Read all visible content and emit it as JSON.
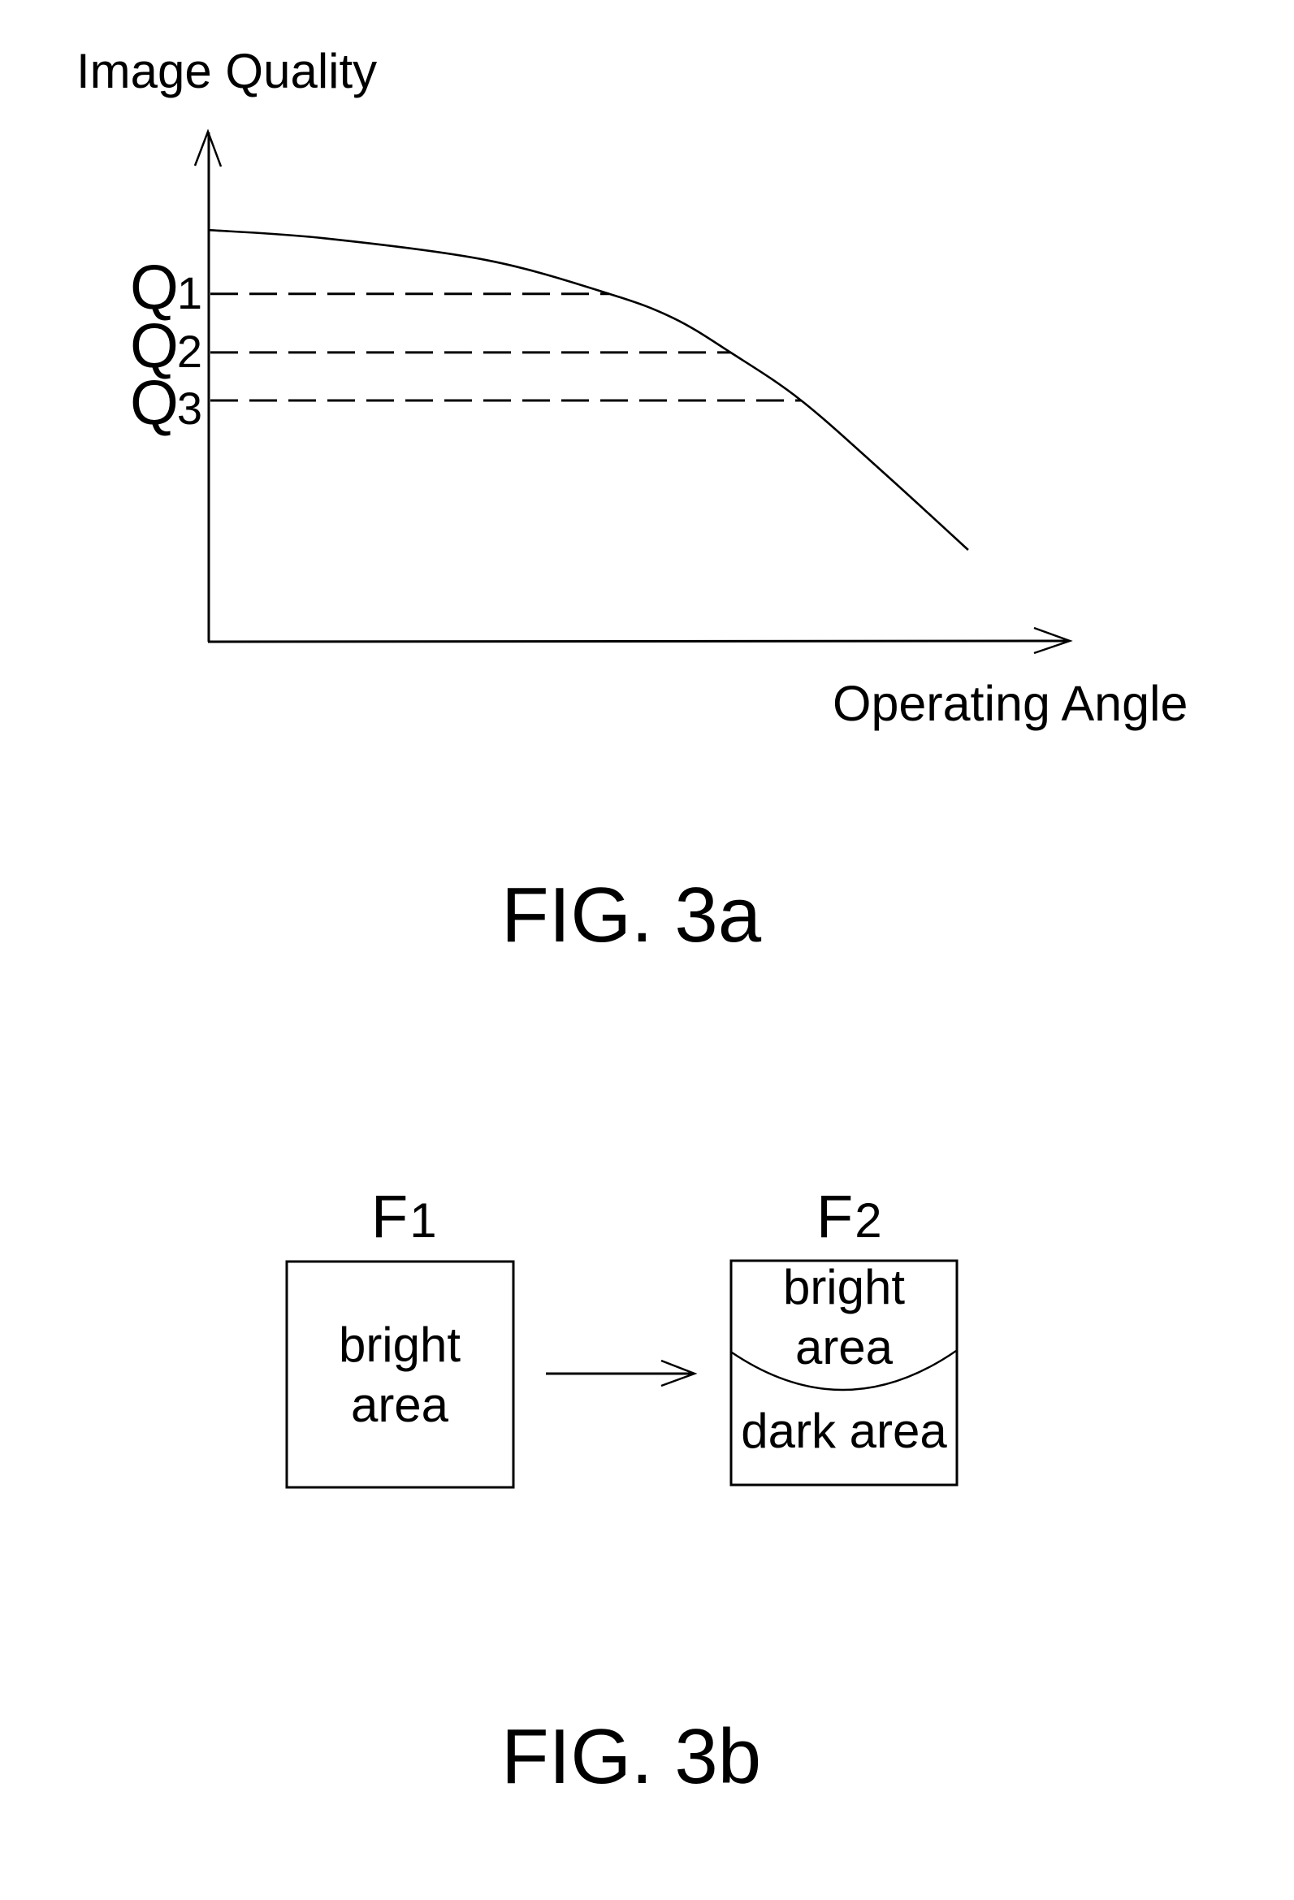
{
  "figure_3a": {
    "caption": "FIG. 3a",
    "y_axis_label": "Image Quality",
    "x_axis_label": "Operating Angle",
    "levels": [
      {
        "main": "Q",
        "sub": "1"
      },
      {
        "main": "Q",
        "sub": "2"
      },
      {
        "main": "Q",
        "sub": "3"
      }
    ]
  },
  "chart_data": {
    "type": "line",
    "title": "",
    "xlabel": "Operating Angle",
    "ylabel": "Image Quality",
    "xlim": [
      0,
      1
    ],
    "ylim": [
      0,
      1
    ],
    "grid": false,
    "legend": "none",
    "x_ticks": [],
    "y_ticks": [
      "Q1",
      "Q2",
      "Q3"
    ],
    "series": [
      {
        "name": "Image Quality vs Operating Angle",
        "x": [
          0.0,
          0.134,
          0.323,
          0.465,
          0.54,
          0.606,
          0.688,
          0.786,
          0.882
        ],
        "y": [
          0.807,
          0.791,
          0.748,
          0.682,
          0.634,
          0.567,
          0.473,
          0.328,
          0.18
        ]
      }
    ],
    "reference_levels": [
      {
        "label": "Q1",
        "value": 0.682,
        "x_intersect": 0.465,
        "style": "dashed"
      },
      {
        "label": "Q2",
        "value": 0.567,
        "x_intersect": 0.606,
        "style": "dashed"
      },
      {
        "label": "Q3",
        "value": 0.473,
        "x_intersect": 0.688,
        "style": "dashed"
      }
    ]
  },
  "figure_3b": {
    "caption": "FIG. 3b",
    "frames": [
      {
        "label_main": "F",
        "label_sub": "1",
        "regions": [
          {
            "name": "bright area",
            "lines": [
              "bright",
              "area"
            ]
          }
        ]
      },
      {
        "label_main": "F",
        "label_sub": "2",
        "regions": [
          {
            "name": "bright area",
            "lines": [
              "bright",
              "area"
            ]
          },
          {
            "name": "dark area",
            "lines": [
              "dark area"
            ]
          }
        ]
      }
    ]
  }
}
